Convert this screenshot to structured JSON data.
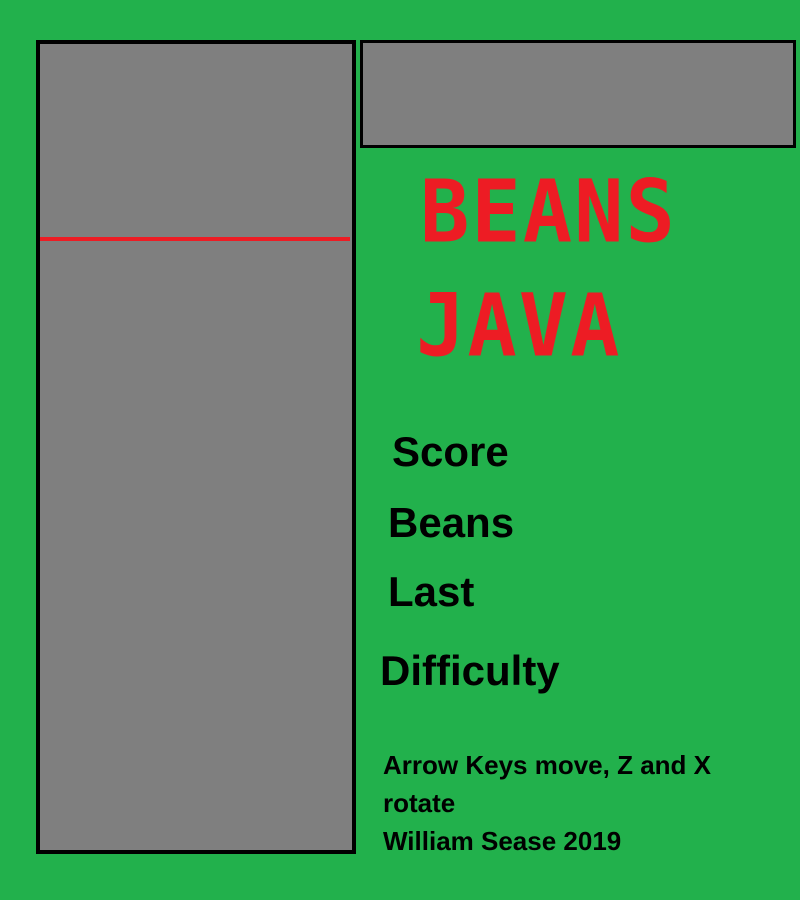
{
  "colors": {
    "background": "#22b14c",
    "panel": "#7f7f7f",
    "border": "#000000",
    "title": "#ed1c24",
    "danger_line": "#ed1c24"
  },
  "title": {
    "line1": "BEANS",
    "line2": "JAVA"
  },
  "stats": {
    "score_label": "Score",
    "beans_label": "Beans",
    "last_label": "Last",
    "difficulty_label": "Difficulty"
  },
  "instructions": {
    "controls_line1": "Arrow Keys move, Z and X",
    "controls_line2": "rotate",
    "credit": "William Sease 2019"
  }
}
